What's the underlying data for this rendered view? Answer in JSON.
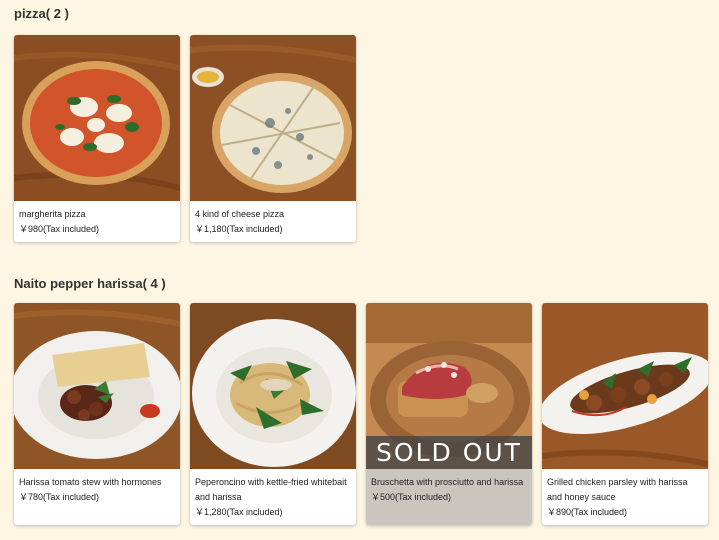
{
  "sections": [
    {
      "title": "pizza( 2 )",
      "items": [
        {
          "name": "margherita pizza",
          "price": "￥980(Tax included)"
        },
        {
          "name": "4 kind of cheese pizza",
          "price": "￥1,180(Tax included)"
        }
      ]
    },
    {
      "title": "Naito pepper harissa( 4 )",
      "items": [
        {
          "name": "Harissa tomato stew with hormones",
          "price": "￥780(Tax included)"
        },
        {
          "name": "Peperoncino with kettle-fried whitebait and harissa",
          "price": "￥1,280(Tax included)"
        },
        {
          "name": "Bruschetta with prosciutto and harissa",
          "price": "￥500(Tax included)",
          "badge": "SOLD OUT"
        },
        {
          "name": "Grilled chicken parsley with harissa and honey sauce",
          "price": "￥890(Tax included)"
        }
      ]
    }
  ]
}
